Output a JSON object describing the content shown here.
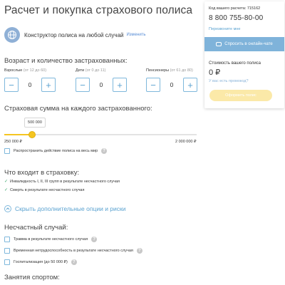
{
  "page": {
    "title": "Расчет и покупка страхового полиса"
  },
  "constructor": {
    "label": "Конструктор полиса на любой случай",
    "change_link": "Изменить",
    "icon": "globe-icon"
  },
  "insured": {
    "title": "Возраст и количество застрахованных:",
    "groups": [
      {
        "label": "Взрослые",
        "hint": "(от 12 до 60)",
        "value": "0",
        "minus": "−",
        "plus": "+"
      },
      {
        "label": "Дети",
        "hint": "(от 0 до 11)",
        "value": "0",
        "minus": "−",
        "plus": "+"
      },
      {
        "label": "Пенсионеры",
        "hint": "(от 61 до 80)",
        "value": "0",
        "minus": "−",
        "plus": "+"
      }
    ]
  },
  "sum": {
    "title": "Страховая сумма на каждого застрахованного:",
    "value": "500 000",
    "min_label": "250 000 ₽",
    "max_label": "2 000 000 ₽",
    "min": 250000,
    "max": 2000000,
    "current": 500000
  },
  "worldwide": {
    "label": "Распространить действие полиса на весь мир"
  },
  "included": {
    "title": "Что входит в страховку:",
    "items": [
      "Инвалидность I, II, III групп в результате несчастного случая",
      "Смерть в результате несчастного случая"
    ]
  },
  "toggle_options": {
    "label": "Скрыть дополнительные опции и риски",
    "icon": "chevron-up-icon"
  },
  "accident": {
    "title": "Несчастный случай:",
    "items": [
      "Травма в результате несчастного случая",
      "Временная нетрудоспособность в результате несчастного случая",
      "Госпитализация (до 50 000 ₽)"
    ]
  },
  "sport": {
    "title": "Занятия спортом:"
  },
  "panel": {
    "calc_code": "Код вашего расчета: 715162",
    "phone": "8 800 755-80-00",
    "callback": "Перезвоните мне",
    "chat_button": "Спросить в онлайн-чате",
    "cost_label": "Стоимость вашего полиса",
    "cost_value": "0 ₽",
    "promo": "У вас есть промокод?",
    "buy_button": "Оформить полис"
  },
  "colors": {
    "accent": "#5aa2d0",
    "slider": "#f5c521",
    "check": "#3aa66b",
    "chat": "#7fb3da",
    "buy": "#fbe9a8"
  }
}
